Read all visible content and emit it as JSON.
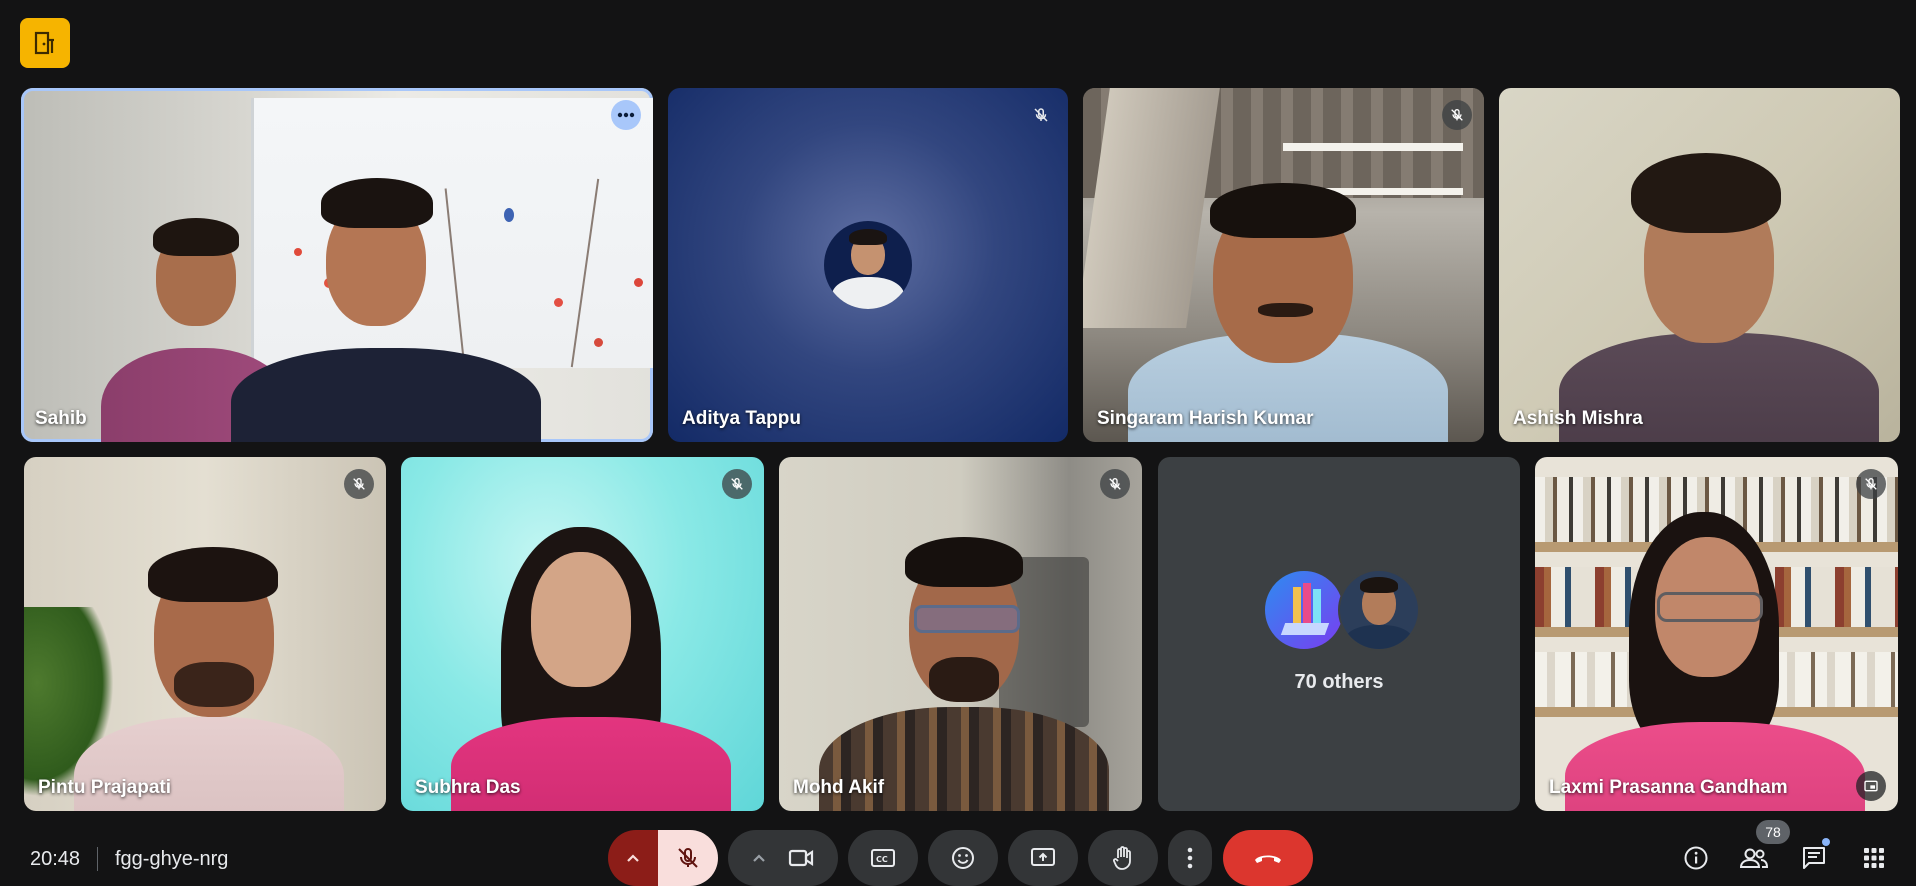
{
  "meeting": {
    "time": "20:48",
    "code": "fgg-ghye-nrg",
    "participant_count": "78"
  },
  "tiles": {
    "sahib": {
      "name": "Sahib"
    },
    "aditya": {
      "name": "Aditya Tappu"
    },
    "singaram": {
      "name": "Singaram Harish Kumar"
    },
    "ashish": {
      "name": "Ashish Mishra"
    },
    "pintu": {
      "name": "Pintu Prajapati"
    },
    "subhra": {
      "name": "Subhra Das"
    },
    "mohd": {
      "name": "Mohd Akif"
    },
    "others": {
      "label": "70 others"
    },
    "laxmi": {
      "name": "Laxmi Prasanna Gandham"
    }
  },
  "colors": {
    "background": "#131314",
    "accent_ring": "#a8c7fa",
    "end_call": "#dc362e",
    "mic_off_bg": "#f9dedc",
    "mic_off_dark": "#8c1d18",
    "logo": "#f6b400"
  },
  "icons": {
    "logo": "door-exit-icon",
    "muted": "mic-off-icon",
    "more": "more-horiz-icon",
    "camera": "videocam-icon",
    "captions": "closed-caption-icon",
    "emoji": "emoji-icon",
    "present": "present-screen-icon",
    "hand": "raise-hand-icon",
    "options": "more-vert-icon",
    "end": "call-end-icon",
    "info": "info-icon",
    "people": "people-icon",
    "chat": "chat-icon",
    "activities": "apps-grid-icon"
  }
}
